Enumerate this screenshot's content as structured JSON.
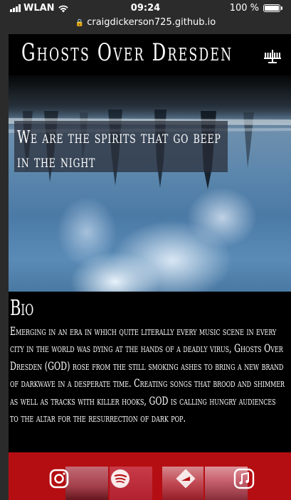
{
  "status_bar": {
    "carrier": "WLAN",
    "time": "09:24",
    "battery": "100 %"
  },
  "browser": {
    "url": "craigdickerson725.github.io"
  },
  "site": {
    "title": "Ghosts Over Dresden"
  },
  "hero": {
    "tagline_line1": "We are the spirits that go beep",
    "tagline_line2": "in the night"
  },
  "bio": {
    "heading": "Bio",
    "text": "Emerging in an era in which quite literally every music scene in every city in the world was dying at the hands of a deadly virus, Ghosts Over Dresden (GOD) rose from the still smoking ashes to bring a new brand of darkwave in a desperate time. Creating songs that brood and shimmer as well as tracks with killer hooks, GOD is calling hungry audiences to the altar for the resurrection of dark pop."
  },
  "footer": {
    "links": [
      "instagram-icon",
      "spotify-icon",
      "soundcloud-icon",
      "apple-music-icon"
    ]
  },
  "colors": {
    "footer_bg": "#b40e12",
    "header_bg": "#000000",
    "page_bg": "#2b2b2b"
  }
}
